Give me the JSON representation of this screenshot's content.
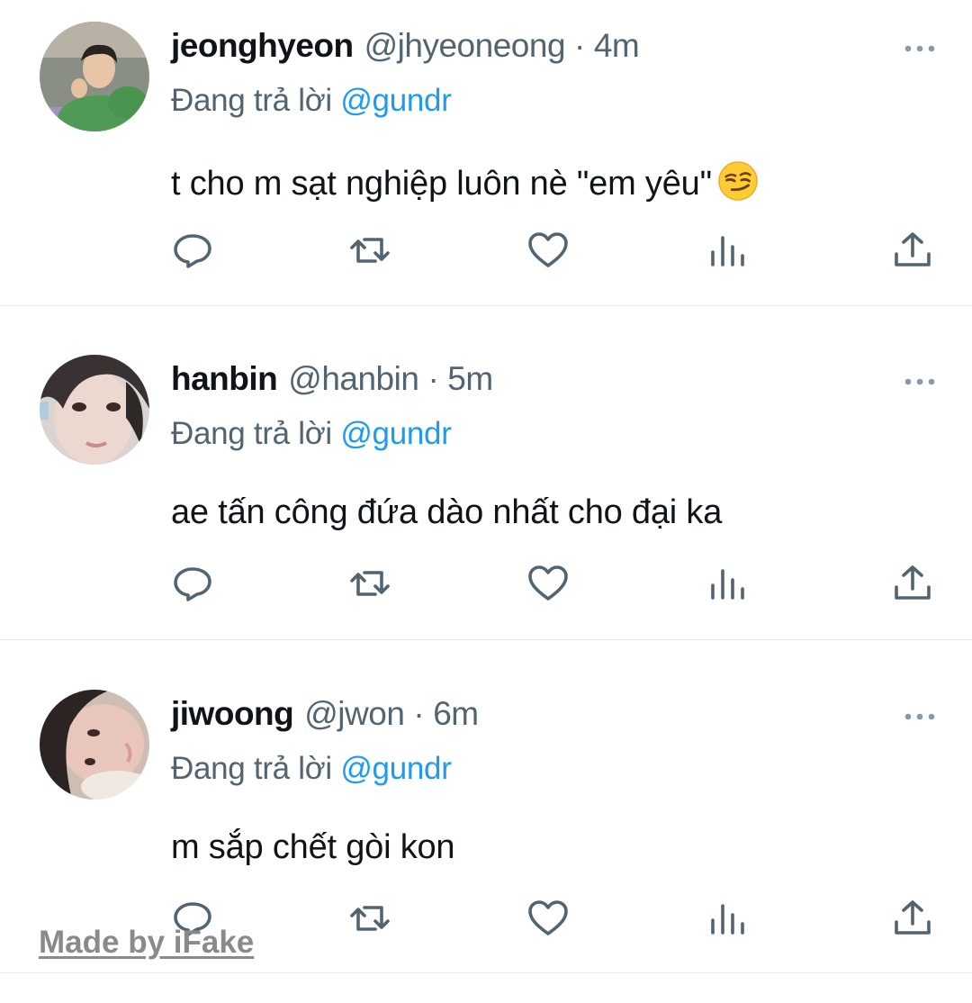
{
  "tweets": [
    {
      "name": "jeonghyeon",
      "handle": "@jhyeoneong",
      "separator": "·",
      "time": "4m",
      "reply_prefix": "Đang trả lời",
      "reply_mention": "@gundr",
      "text": "t cho m sạt nghiệp luôn nè \"em yêu\"",
      "emoji": "smirking-face-emoji",
      "avatar": "avatar-photo-green-sweater"
    },
    {
      "name": "hanbin",
      "handle": "@hanbin",
      "separator": "·",
      "time": "5m",
      "reply_prefix": "Đang trả lời",
      "reply_mention": "@gundr",
      "text": "ae tấn công đứa dào nhất cho đại ka",
      "avatar": "avatar-photo-selfie"
    },
    {
      "name": "jiwoong",
      "handle": "@jwon",
      "separator": "·",
      "time": "6m",
      "reply_prefix": "Đang trả lời",
      "reply_mention": "@gundr",
      "text": "m sắp chết gòi kon",
      "avatar": "avatar-photo-lying-down"
    }
  ],
  "actions": [
    "reply-icon",
    "retweet-icon",
    "like-icon",
    "views-icon",
    "share-icon"
  ],
  "watermark": "Made by iFake",
  "colors": {
    "text": "#0f1419",
    "secondary": "#536471",
    "mention": "#1d9bf0",
    "divider": "#e6e9eb",
    "watermark": "#8a8a8a"
  }
}
